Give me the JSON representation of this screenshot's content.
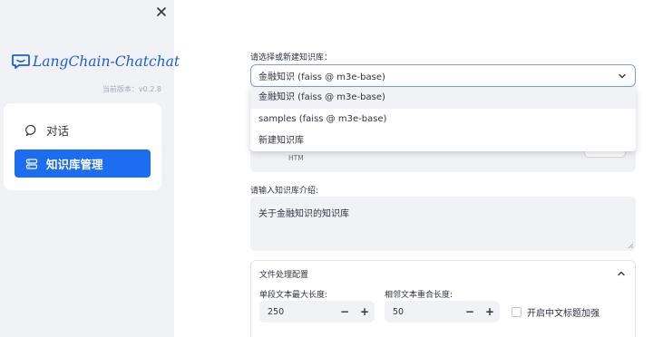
{
  "sidebar": {
    "brand": "LangChain-Chatchat",
    "version": "当前版本：v0.2.8",
    "nav": [
      {
        "label": "对话",
        "icon": "chat-bubble-icon",
        "active": false
      },
      {
        "label": "知识库管理",
        "icon": "database-icon",
        "active": true
      }
    ]
  },
  "main": {
    "kb_select_label": "请选择或新建知识库：",
    "kb_select_value": "金融知识 (faiss @ m3e-base)",
    "kb_options": [
      "金融知识 (faiss @ m3e-base)",
      "samples (faiss @ m3e-base)",
      "新建知识库"
    ],
    "hidden_text": "HTM",
    "intro_label": "请输入知识库介绍:",
    "intro_value": "关于金融知识的知识库",
    "file_config": {
      "title": "文件处理配置",
      "chunk_size_label": "单段文本最大长度:",
      "chunk_size_value": "250",
      "overlap_label": "相邻文本重合长度:",
      "overlap_value": "50",
      "zh_title_label": "开启中文标题加强",
      "minus": "−",
      "plus": "+"
    }
  },
  "colors": {
    "accent": "#1c6df0",
    "sidebar_bg": "#f0f2f6",
    "brand": "#1d5fd0"
  }
}
